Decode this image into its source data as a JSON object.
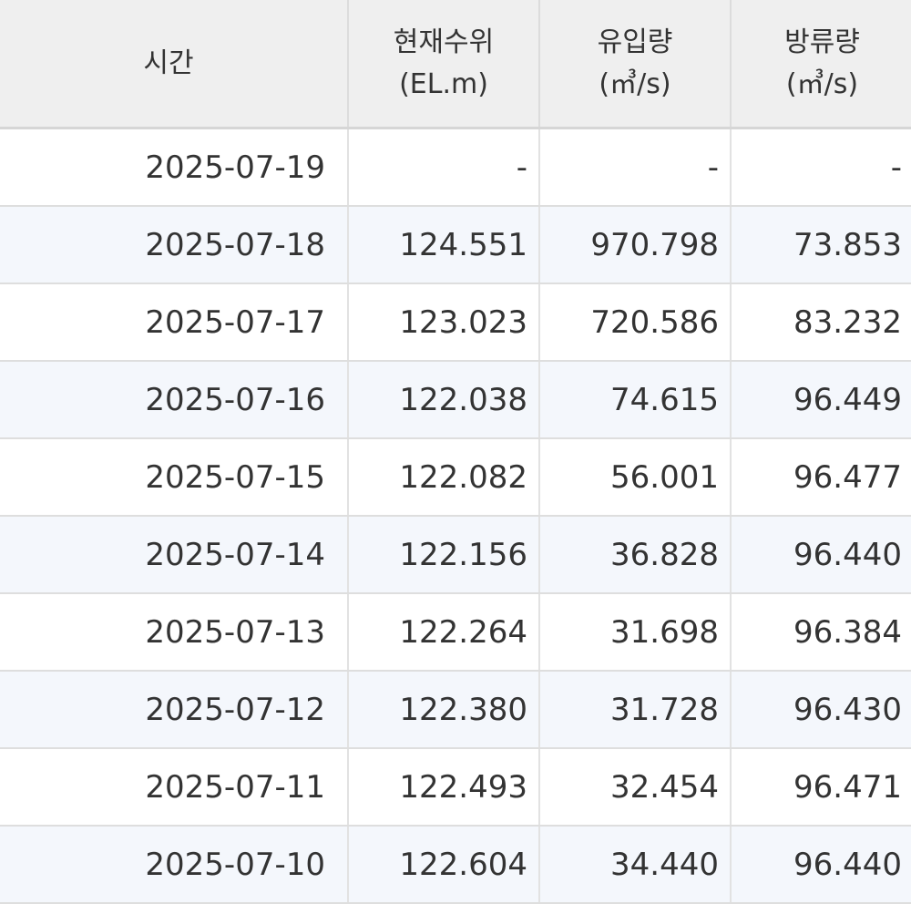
{
  "table": {
    "headers": [
      {
        "line1": "시간",
        "line2": ""
      },
      {
        "line1": "현재수위",
        "line2": "(EL.m)"
      },
      {
        "line1": "유입량",
        "line2": "(㎥/s)"
      },
      {
        "line1": "방류량",
        "line2": "(㎥/s)"
      }
    ],
    "rows": [
      {
        "time": "2025-07-19",
        "level": "-",
        "inflow": "-",
        "outflow": "-"
      },
      {
        "time": "2025-07-18",
        "level": "124.551",
        "inflow": "970.798",
        "outflow": "73.853"
      },
      {
        "time": "2025-07-17",
        "level": "123.023",
        "inflow": "720.586",
        "outflow": "83.232"
      },
      {
        "time": "2025-07-16",
        "level": "122.038",
        "inflow": "74.615",
        "outflow": "96.449"
      },
      {
        "time": "2025-07-15",
        "level": "122.082",
        "inflow": "56.001",
        "outflow": "96.477"
      },
      {
        "time": "2025-07-14",
        "level": "122.156",
        "inflow": "36.828",
        "outflow": "96.440"
      },
      {
        "time": "2025-07-13",
        "level": "122.264",
        "inflow": "31.698",
        "outflow": "96.384"
      },
      {
        "time": "2025-07-12",
        "level": "122.380",
        "inflow": "31.728",
        "outflow": "96.430"
      },
      {
        "time": "2025-07-11",
        "level": "122.493",
        "inflow": "32.454",
        "outflow": "96.471"
      },
      {
        "time": "2025-07-10",
        "level": "122.604",
        "inflow": "34.440",
        "outflow": "96.440"
      }
    ]
  },
  "colors": {
    "header_bg": "#efefef",
    "row_alt_bg": "#f4f7fc",
    "text": "#333333"
  }
}
